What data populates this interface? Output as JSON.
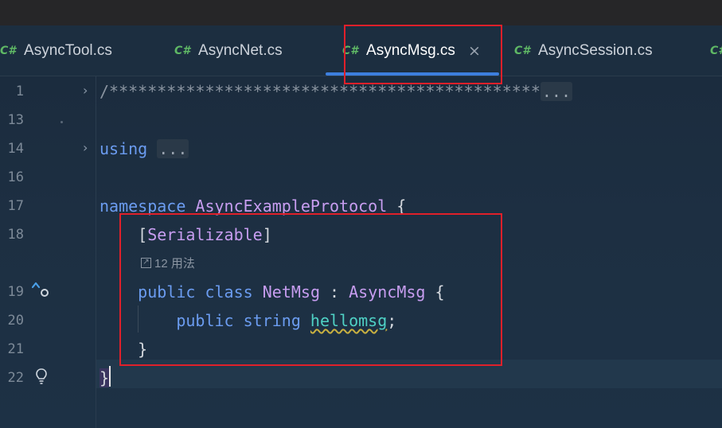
{
  "tabs": [
    {
      "icon": "C#",
      "label": "AsyncTool.cs",
      "active": false
    },
    {
      "icon": "C#",
      "label": "AsyncNet.cs",
      "active": false
    },
    {
      "icon": "C#",
      "label": "AsyncMsg.cs",
      "active": true,
      "close": "×"
    },
    {
      "icon": "C#",
      "label": "AsyncSession.cs",
      "active": false
    },
    {
      "icon": "C#",
      "label": "",
      "active": false
    }
  ],
  "line_numbers": [
    "1",
    "13",
    "14",
    "16",
    "17",
    "18",
    "19",
    "20",
    "21",
    "22"
  ],
  "code": {
    "line1_comment": "/*********************************************",
    "line1_fold": "...",
    "using_kw": "using",
    "using_fold": "...",
    "namespace_kw": "namespace",
    "namespace_name": "AsyncExampleProtocol",
    "open_brace": "{",
    "attr_open": "[",
    "attr_name": "Serializable",
    "attr_close": "]",
    "usages_hint": "12 用法",
    "public_kw": "public",
    "class_kw": "class",
    "class_name": "NetMsg",
    "colon": ":",
    "base_class": "AsyncMsg",
    "string_kw": "string",
    "field_name": "hellomsg",
    "semicolon": ";",
    "close_brace": "}"
  },
  "colors": {
    "keyword": "#6b9cf0",
    "type": "#c79df0",
    "field": "#4fd1c5",
    "highlight_box": "#e0202a",
    "active_tab_underline": "#3d7fde"
  }
}
